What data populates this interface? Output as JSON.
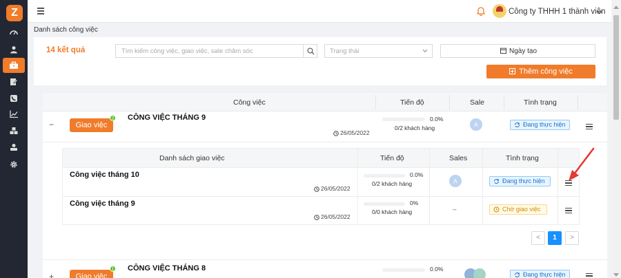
{
  "header": {
    "company": "Công ty THHH 1 thành viên"
  },
  "breadcrumb": "Danh sách công việc",
  "filters": {
    "result_count": "14 kết quả",
    "search_placeholder": "Tìm kiếm công việc, giao việc, sale chăm sóc",
    "status_placeholder": "Trạng thái",
    "date_label": "Ngày tạo",
    "add_label": "Thêm công việc"
  },
  "table": {
    "columns": [
      "Công việc",
      "Tiến độ",
      "Sale",
      "Tình trạng"
    ],
    "rows": [
      {
        "toggle": "−",
        "assign_label": "Giao việc",
        "badge_count": "2",
        "title": "CÔNG VIỆC THÁNG 9",
        "date": "26/05/2022",
        "progress_pct": "0.0%",
        "progress_customers": "0/2 khách hàng",
        "sale_avatar": "A",
        "status": "Đang thực hiện",
        "status_color": "#1a73c9"
      },
      {
        "toggle": "+",
        "assign_label": "Giao việc",
        "badge_count": "1",
        "title": "CÔNG VIỆC THÁNG 8",
        "date": "",
        "progress_pct": "0.0%",
        "progress_customers": "",
        "sale_avatar": "",
        "status": "Đang thực hiện",
        "status_color": "#1a73c9"
      }
    ]
  },
  "sub_table": {
    "columns": [
      "Danh sách giao việc",
      "Tiến độ",
      "Sales",
      "Tình trạng"
    ],
    "rows": [
      {
        "title": "Công việc tháng 10",
        "date": "26/05/2022",
        "progress_pct": "0.0%",
        "progress_customers": "0/2 khách hàng",
        "sale_avatar": "A",
        "status": "Đang thực hiện",
        "status_color": "#1a73c9"
      },
      {
        "title": "Công việc tháng 9",
        "date": "26/05/2022",
        "progress_pct": "0%",
        "progress_customers": "0/0 khách hàng",
        "sale_avatar": "--",
        "status": "Chờ giao việc",
        "status_color": "#d48806"
      }
    ],
    "pagination": {
      "prev": "<",
      "current": "1",
      "next": ">"
    }
  },
  "colors": {
    "accent": "#f07c2b",
    "sidebar": "#222733",
    "primary_blue": "#1890ff",
    "annotation_arrow": "#e53935"
  }
}
